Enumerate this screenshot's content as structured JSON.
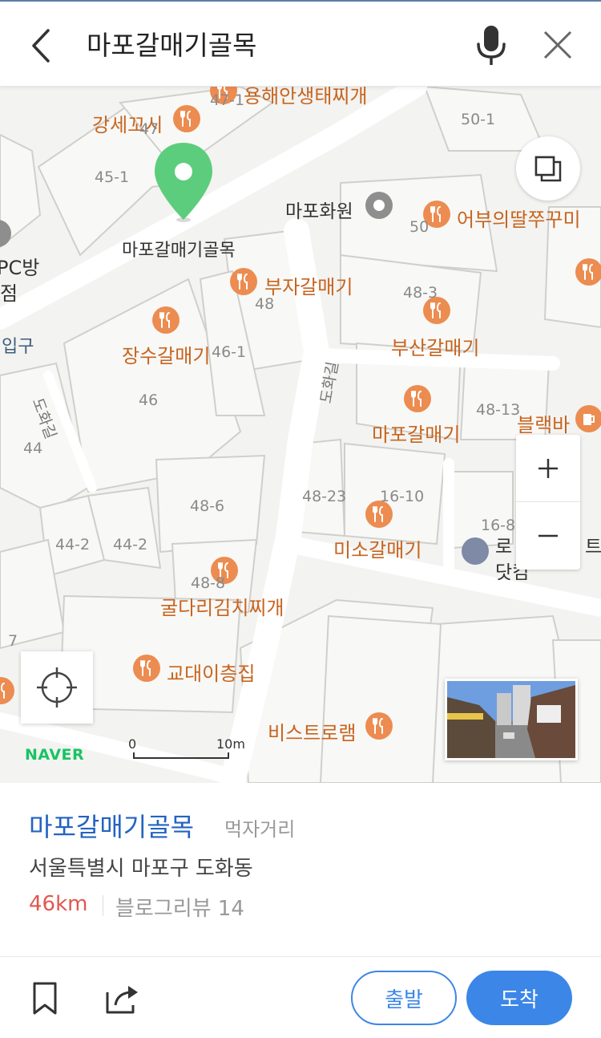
{
  "header": {
    "search_query": "마포갈매기골목"
  },
  "map": {
    "selected_marker_label": "마포갈매기골목",
    "pois": [
      {
        "name": "강세꼬시"
      },
      {
        "name": "용해안생태찌개"
      },
      {
        "name": "어부의딸쭈꾸미"
      },
      {
        "name": "부자갈매기"
      },
      {
        "name": "장수갈매기"
      },
      {
        "name": "부산갈매기"
      },
      {
        "name": "마포갈매기"
      },
      {
        "name": "블랙바"
      },
      {
        "name": "미소갈매기"
      },
      {
        "name": "굴다리김치찌개"
      },
      {
        "name": "교대이층집"
      },
      {
        "name": "비스트로램"
      }
    ],
    "landmark": "마포화원",
    "partial_labels": {
      "pc_room_top": "PC방",
      "pc_room_bottom": "점",
      "entrance": "입구",
      "right_partial_top": "로",
      "right_partial_bottom": "닷컴",
      "right_partial_suffix": "트"
    },
    "lot_numbers": [
      "47-1",
      "47",
      "45-1",
      "50-1",
      "50",
      "48-3",
      "48",
      "46-1",
      "46",
      "44",
      "48-13",
      "48-23",
      "16-10",
      "48-6",
      "44-2",
      "44-2",
      "48-8",
      "16-8",
      "7"
    ],
    "road_names": [
      "도화길",
      "도화길"
    ],
    "scale": {
      "zero": "0",
      "max": "10m"
    },
    "logo": "NAVER"
  },
  "place": {
    "name": "마포갈매기골목",
    "category": "먹자거리",
    "address": "서울특별시 마포구 도화동",
    "distance": "46km",
    "review_label": "블로그리뷰 14"
  },
  "actions": {
    "depart_label": "출발",
    "arrive_label": "도착"
  },
  "colors": {
    "accent": "#3c86e8",
    "poi": "#c8641e",
    "marker": "#5ccd7c",
    "distance": "#e0584f"
  }
}
